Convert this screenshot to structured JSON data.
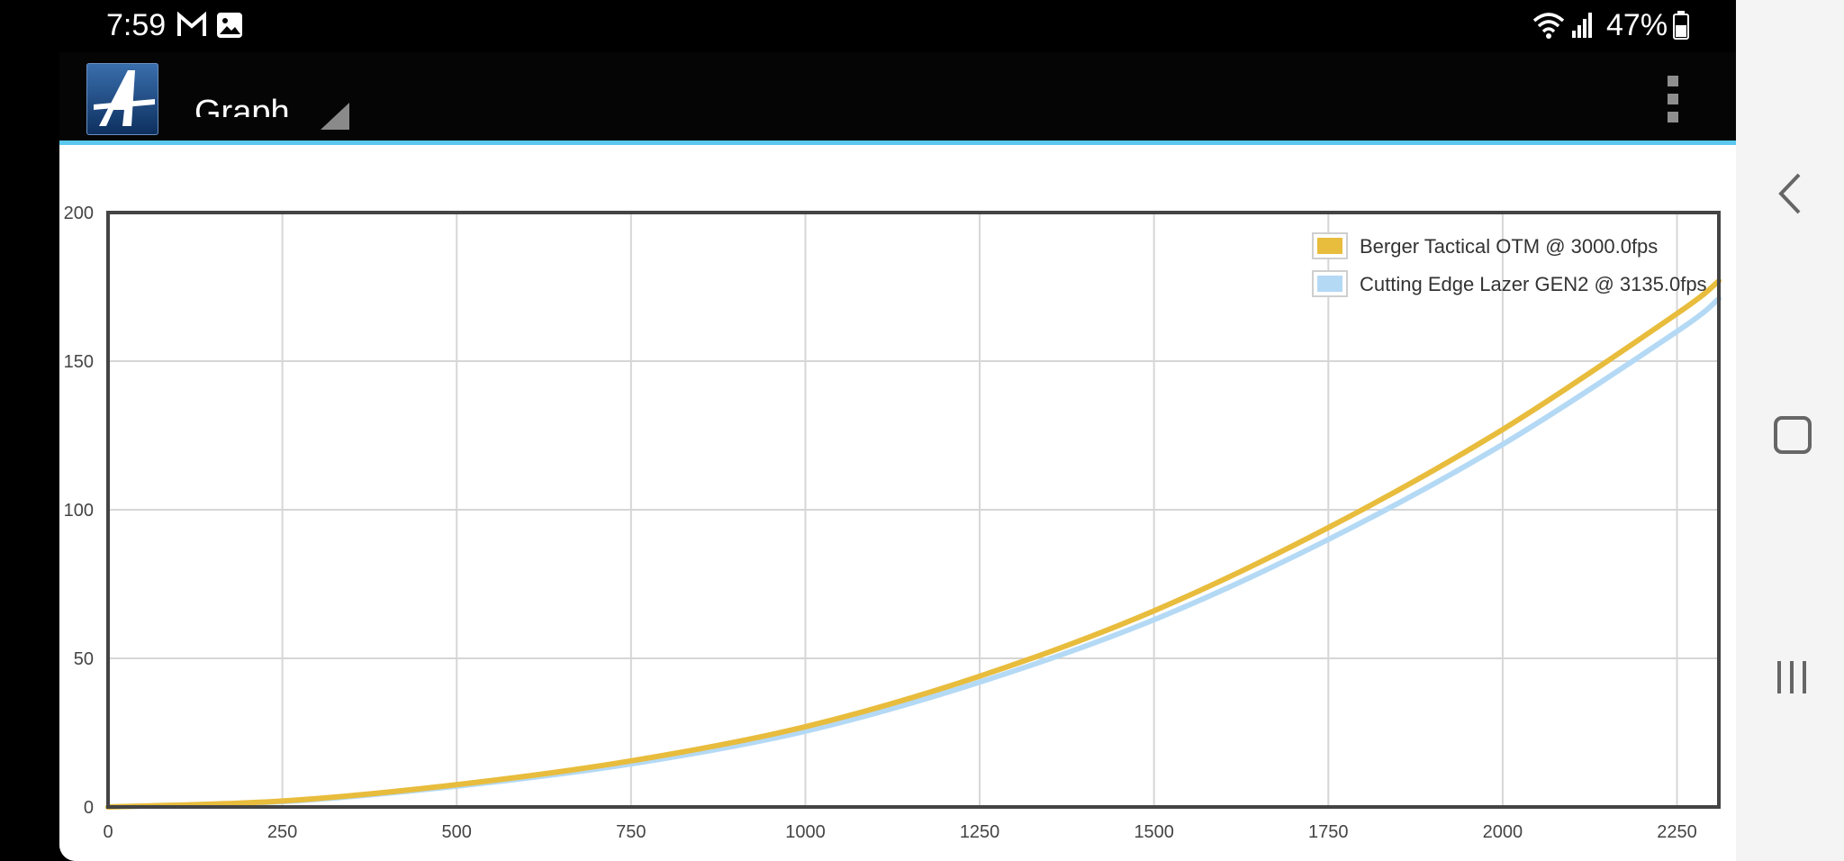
{
  "status_bar": {
    "time": "7:59",
    "battery_percent": "47%",
    "icons": [
      "gmail-icon",
      "gallery-icon",
      "wifi-icon",
      "signal-icon",
      "battery-icon"
    ]
  },
  "action_bar": {
    "title": "Graph",
    "logo": "app-logo",
    "accent_color": "#5cc8ee"
  },
  "nav_bar": {
    "buttons": [
      "back-icon",
      "home-icon",
      "recents-icon"
    ]
  },
  "chart_data": {
    "type": "line",
    "title": "",
    "xlabel": "",
    "ylabel": "",
    "xlim": [
      0,
      2310
    ],
    "ylim": [
      0,
      200
    ],
    "x_ticks": [
      0,
      250,
      500,
      750,
      1000,
      1250,
      1500,
      1750,
      2000,
      2250
    ],
    "y_ticks": [
      0,
      50,
      100,
      150,
      200
    ],
    "grid": true,
    "legend_position": "top-right",
    "x": [
      0,
      250,
      500,
      750,
      1000,
      1250,
      1500,
      1750,
      2000,
      2250,
      2310
    ],
    "series": [
      {
        "name": "Berger Tactical OTM @ 3000.0fps",
        "color": "#e8bc3c",
        "values": [
          0,
          2,
          7.5,
          15.5,
          27,
          44,
          66,
          94,
          127,
          166,
          177
        ]
      },
      {
        "name": "Cutting Edge Lazer GEN2 @ 3135.0fps",
        "color": "#b4d9f5",
        "values": [
          0,
          1.8,
          7,
          14.5,
          25.5,
          42,
          63,
          90,
          122,
          160,
          171
        ]
      }
    ]
  }
}
